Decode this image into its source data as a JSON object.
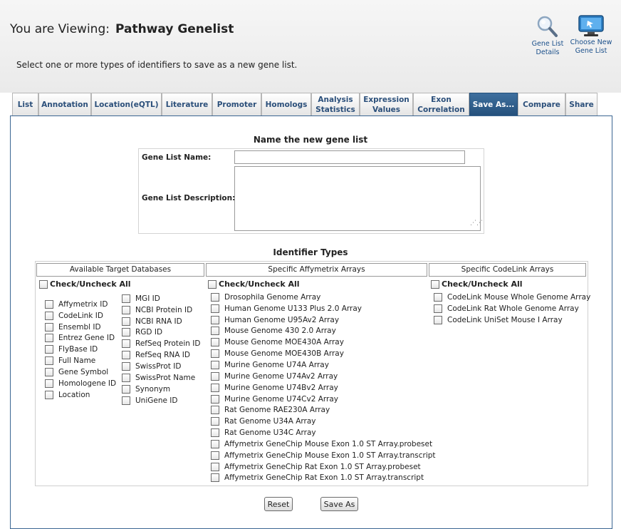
{
  "header": {
    "viewing_label": "You are Viewing:",
    "list_name": "Pathway Genelist",
    "subtitle": "Select one or more types of identifiers to save as a new gene list."
  },
  "actions": {
    "details": "Gene List Details",
    "choose": "Choose New Gene List"
  },
  "tabs": [
    {
      "label": "List"
    },
    {
      "label": "Annotation"
    },
    {
      "label": "Location(eQTL)"
    },
    {
      "label": "Literature"
    },
    {
      "label": "Promoter"
    },
    {
      "label": "Homologs"
    },
    {
      "label": "Analysis Statistics"
    },
    {
      "label": "Expression Values"
    },
    {
      "label": "Exon Correlation"
    },
    {
      "label": "Save As..."
    },
    {
      "label": "Compare"
    },
    {
      "label": "Share"
    }
  ],
  "active_tab": "Save As...",
  "form": {
    "title": "Name the new gene list",
    "name_label": "Gene List Name:",
    "name_value": "",
    "desc_label": "Gene List Description:",
    "desc_value": ""
  },
  "identifiers": {
    "title": "Identifier Types",
    "col1_header": "Available Target Databases",
    "col2_header": "Specific Affymetrix Arrays",
    "col3_header": "Specific CodeLink Arrays",
    "check_all": "Check/Uncheck All",
    "databases_left": [
      "Affymetrix ID",
      "CodeLink ID",
      "Ensembl ID",
      "Entrez Gene ID",
      "FlyBase ID",
      "Full Name",
      "Gene Symbol",
      "Homologene ID",
      "Location"
    ],
    "databases_right": [
      "MGI ID",
      "NCBI Protein ID",
      "NCBI RNA ID",
      "RGD ID",
      "RefSeq Protein ID",
      "RefSeq RNA ID",
      "SwissProt ID",
      "SwissProt Name",
      "Synonym",
      "UniGene ID"
    ],
    "affy_arrays": [
      "Drosophila Genome Array",
      "Human Genome U133 Plus 2.0 Array",
      "Human Genome U95Av2 Array",
      "Mouse Genome 430 2.0 Array",
      "Mouse Genome MOE430A Array",
      "Mouse Genome MOE430B Array",
      "Murine Genome U74A Array",
      "Murine Genome U74Av2 Array",
      "Murine Genome U74Bv2 Array",
      "Murine Genome U74Cv2 Array",
      "Rat Genome RAE230A Array",
      "Rat Genome U34A Array",
      "Rat Genome U34C Array",
      "Affymetrix GeneChip Mouse Exon 1.0 ST Array.probeset",
      "Affymetrix GeneChip Mouse Exon 1.0 ST Array.transcript",
      "Affymetrix GeneChip Rat Exon 1.0 ST Array.probeset",
      "Affymetrix GeneChip Rat Exon 1.0 ST Array.transcript"
    ],
    "codelink_arrays": [
      "CodeLink Mouse Whole Genome Array",
      "CodeLink Rat Whole Genome Array",
      "CodeLink UniSet Mouse I Array"
    ]
  },
  "buttons": {
    "reset": "Reset",
    "save_as": "Save As"
  },
  "colors": {
    "active_tab": "#25517c",
    "tab_text": "#2b4f7a",
    "panel_border": "#3a6592"
  }
}
